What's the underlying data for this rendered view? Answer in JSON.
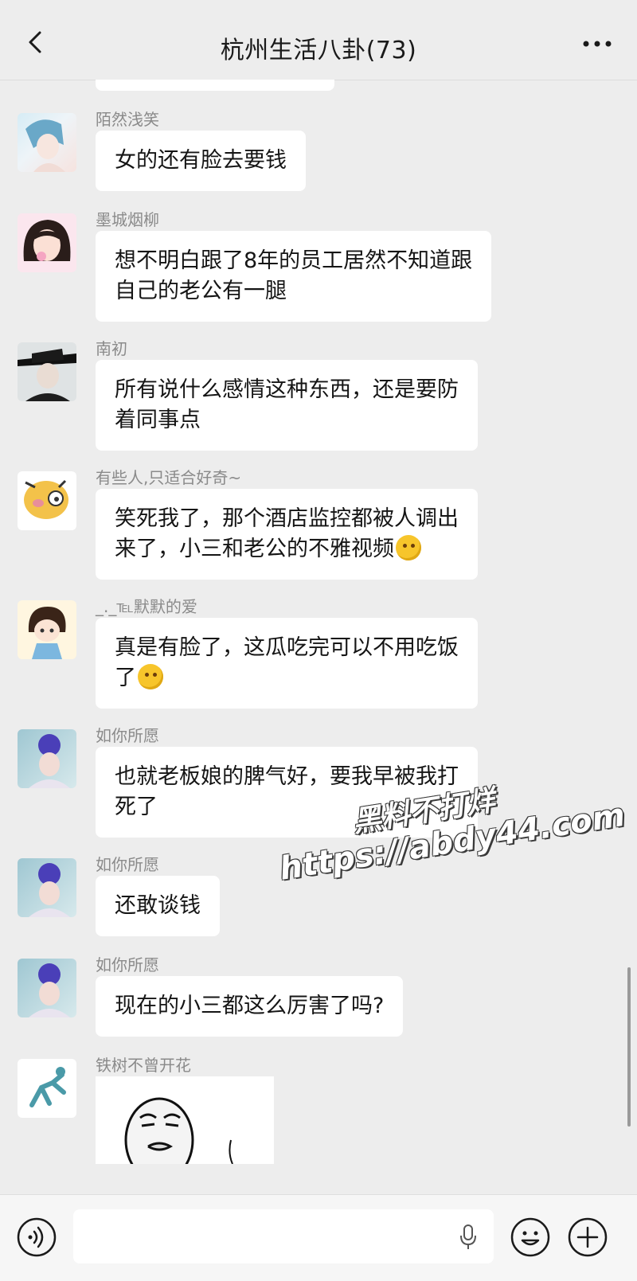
{
  "header": {
    "title": "杭州生活八卦(73)",
    "back_icon": "chevron-left-icon",
    "more_icon": "more-dots-icon"
  },
  "messages": [
    {
      "sender": "陌然浅笑",
      "lines": [
        "女的还有脸去要钱"
      ]
    },
    {
      "sender": "墨城烟柳",
      "lines": [
        "想不明白跟了8年的员工居然不知道跟",
        "自己的老公有一腿"
      ]
    },
    {
      "sender": "南初",
      "lines": [
        "所有说什么感情这种东西，还是要防",
        "着同事点"
      ]
    },
    {
      "sender": "有些人,只适合好奇~",
      "lines": [
        "笑死我了，那个酒店监控都被人调出",
        "来了，小三和老公的不雅视频"
      ],
      "emoji": "thinking-face-emoji"
    },
    {
      "sender": "_._℡默默的爱",
      "lines": [
        "真是有脸了，这瓜吃完可以不用吃饭",
        "了"
      ],
      "emoji": "rolling-laughing-emoji"
    },
    {
      "sender": "如你所愿",
      "lines": [
        "也就老板娘的脾气好，要我早被我打",
        "死了"
      ]
    },
    {
      "sender": "如你所愿",
      "lines": [
        "还敢谈钱"
      ]
    },
    {
      "sender": "如你所愿",
      "lines": [
        "现在的小三都这么厉害了吗?"
      ]
    },
    {
      "sender": "铁树不曾开花",
      "sticker": "meme-face-sticker"
    }
  ],
  "watermark": {
    "line1": "黑料不打烊",
    "line2": "https://abdy44.com"
  },
  "input_bar": {
    "voice_icon": "voice-icon",
    "mic_icon": "microphone-icon",
    "emoji_icon": "emoji-icon",
    "plus_icon": "plus-icon"
  },
  "colors": {
    "background": "#ededed",
    "bubble": "#ffffff",
    "sender_name": "#8a8a8a"
  }
}
